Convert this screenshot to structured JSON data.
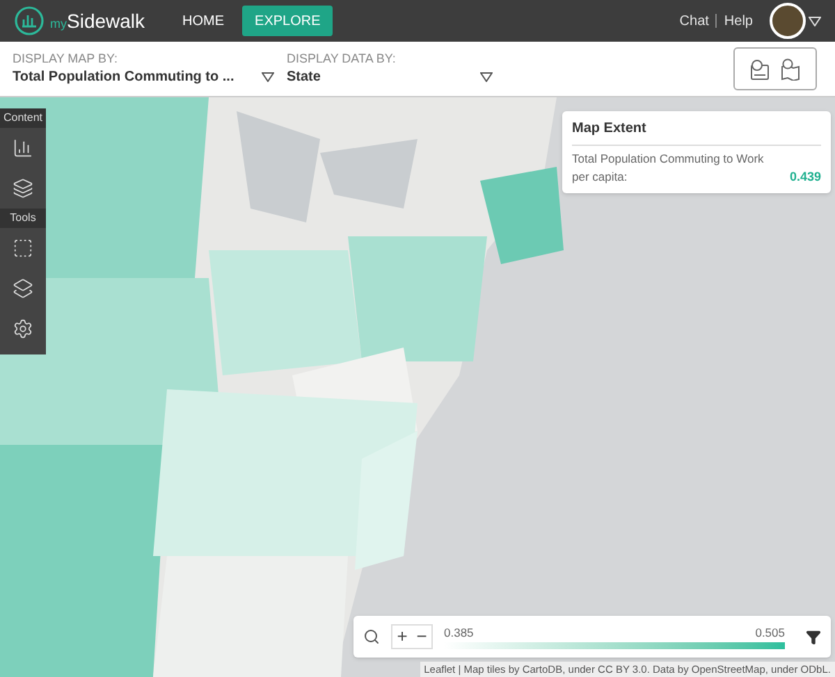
{
  "header": {
    "logo": {
      "prefix": "my",
      "name": "Sidewalk"
    },
    "nav": [
      {
        "label": "HOME",
        "selected": false
      },
      {
        "label": "EXPLORE",
        "selected": true
      }
    ],
    "links": [
      "Chat",
      "Help"
    ]
  },
  "toolbar": {
    "map_by": {
      "label": "DISPLAY MAP BY:",
      "value": "Total Population Commuting to ..."
    },
    "data_by": {
      "label": "DISPLAY DATA BY:",
      "value": "State"
    }
  },
  "side_panel": {
    "sections": [
      {
        "title": "Content",
        "tools": [
          {
            "kind": "chart"
          },
          {
            "kind": "layers"
          }
        ]
      },
      {
        "title": "Tools",
        "tools": [
          {
            "kind": "select"
          },
          {
            "kind": "add_layer"
          },
          {
            "kind": "settings"
          }
        ]
      }
    ]
  },
  "extent_card": {
    "title": "Map Extent",
    "label": "Total Population Commuting to Work per capita:",
    "value": "0.439"
  },
  "legend": {
    "min": "0.385",
    "max": "0.505",
    "zoom_in": "+",
    "zoom_out": "−"
  },
  "attribution": "Leaflet | Map tiles by CartoDB, under CC BY 3.0. Data by OpenStreetMap, under ODbL."
}
